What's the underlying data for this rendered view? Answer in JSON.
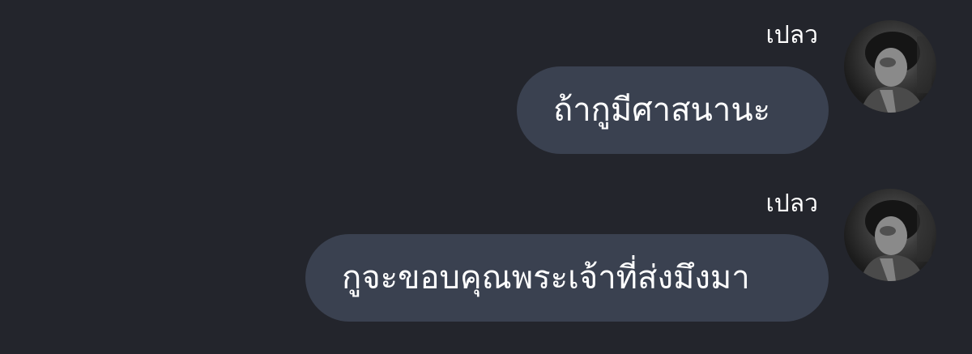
{
  "messages": [
    {
      "sender": "เปลว",
      "text": "ถ้ากูมีศาสนานะ",
      "avatar_icon": "user-avatar"
    },
    {
      "sender": "เปลว",
      "text": "กูจะขอบคุณพระเจ้าที่ส่งมึงมา",
      "avatar_icon": "user-avatar"
    }
  ],
  "colors": {
    "background": "#23252c",
    "bubble": "#3a4150",
    "text": "#ffffff"
  }
}
